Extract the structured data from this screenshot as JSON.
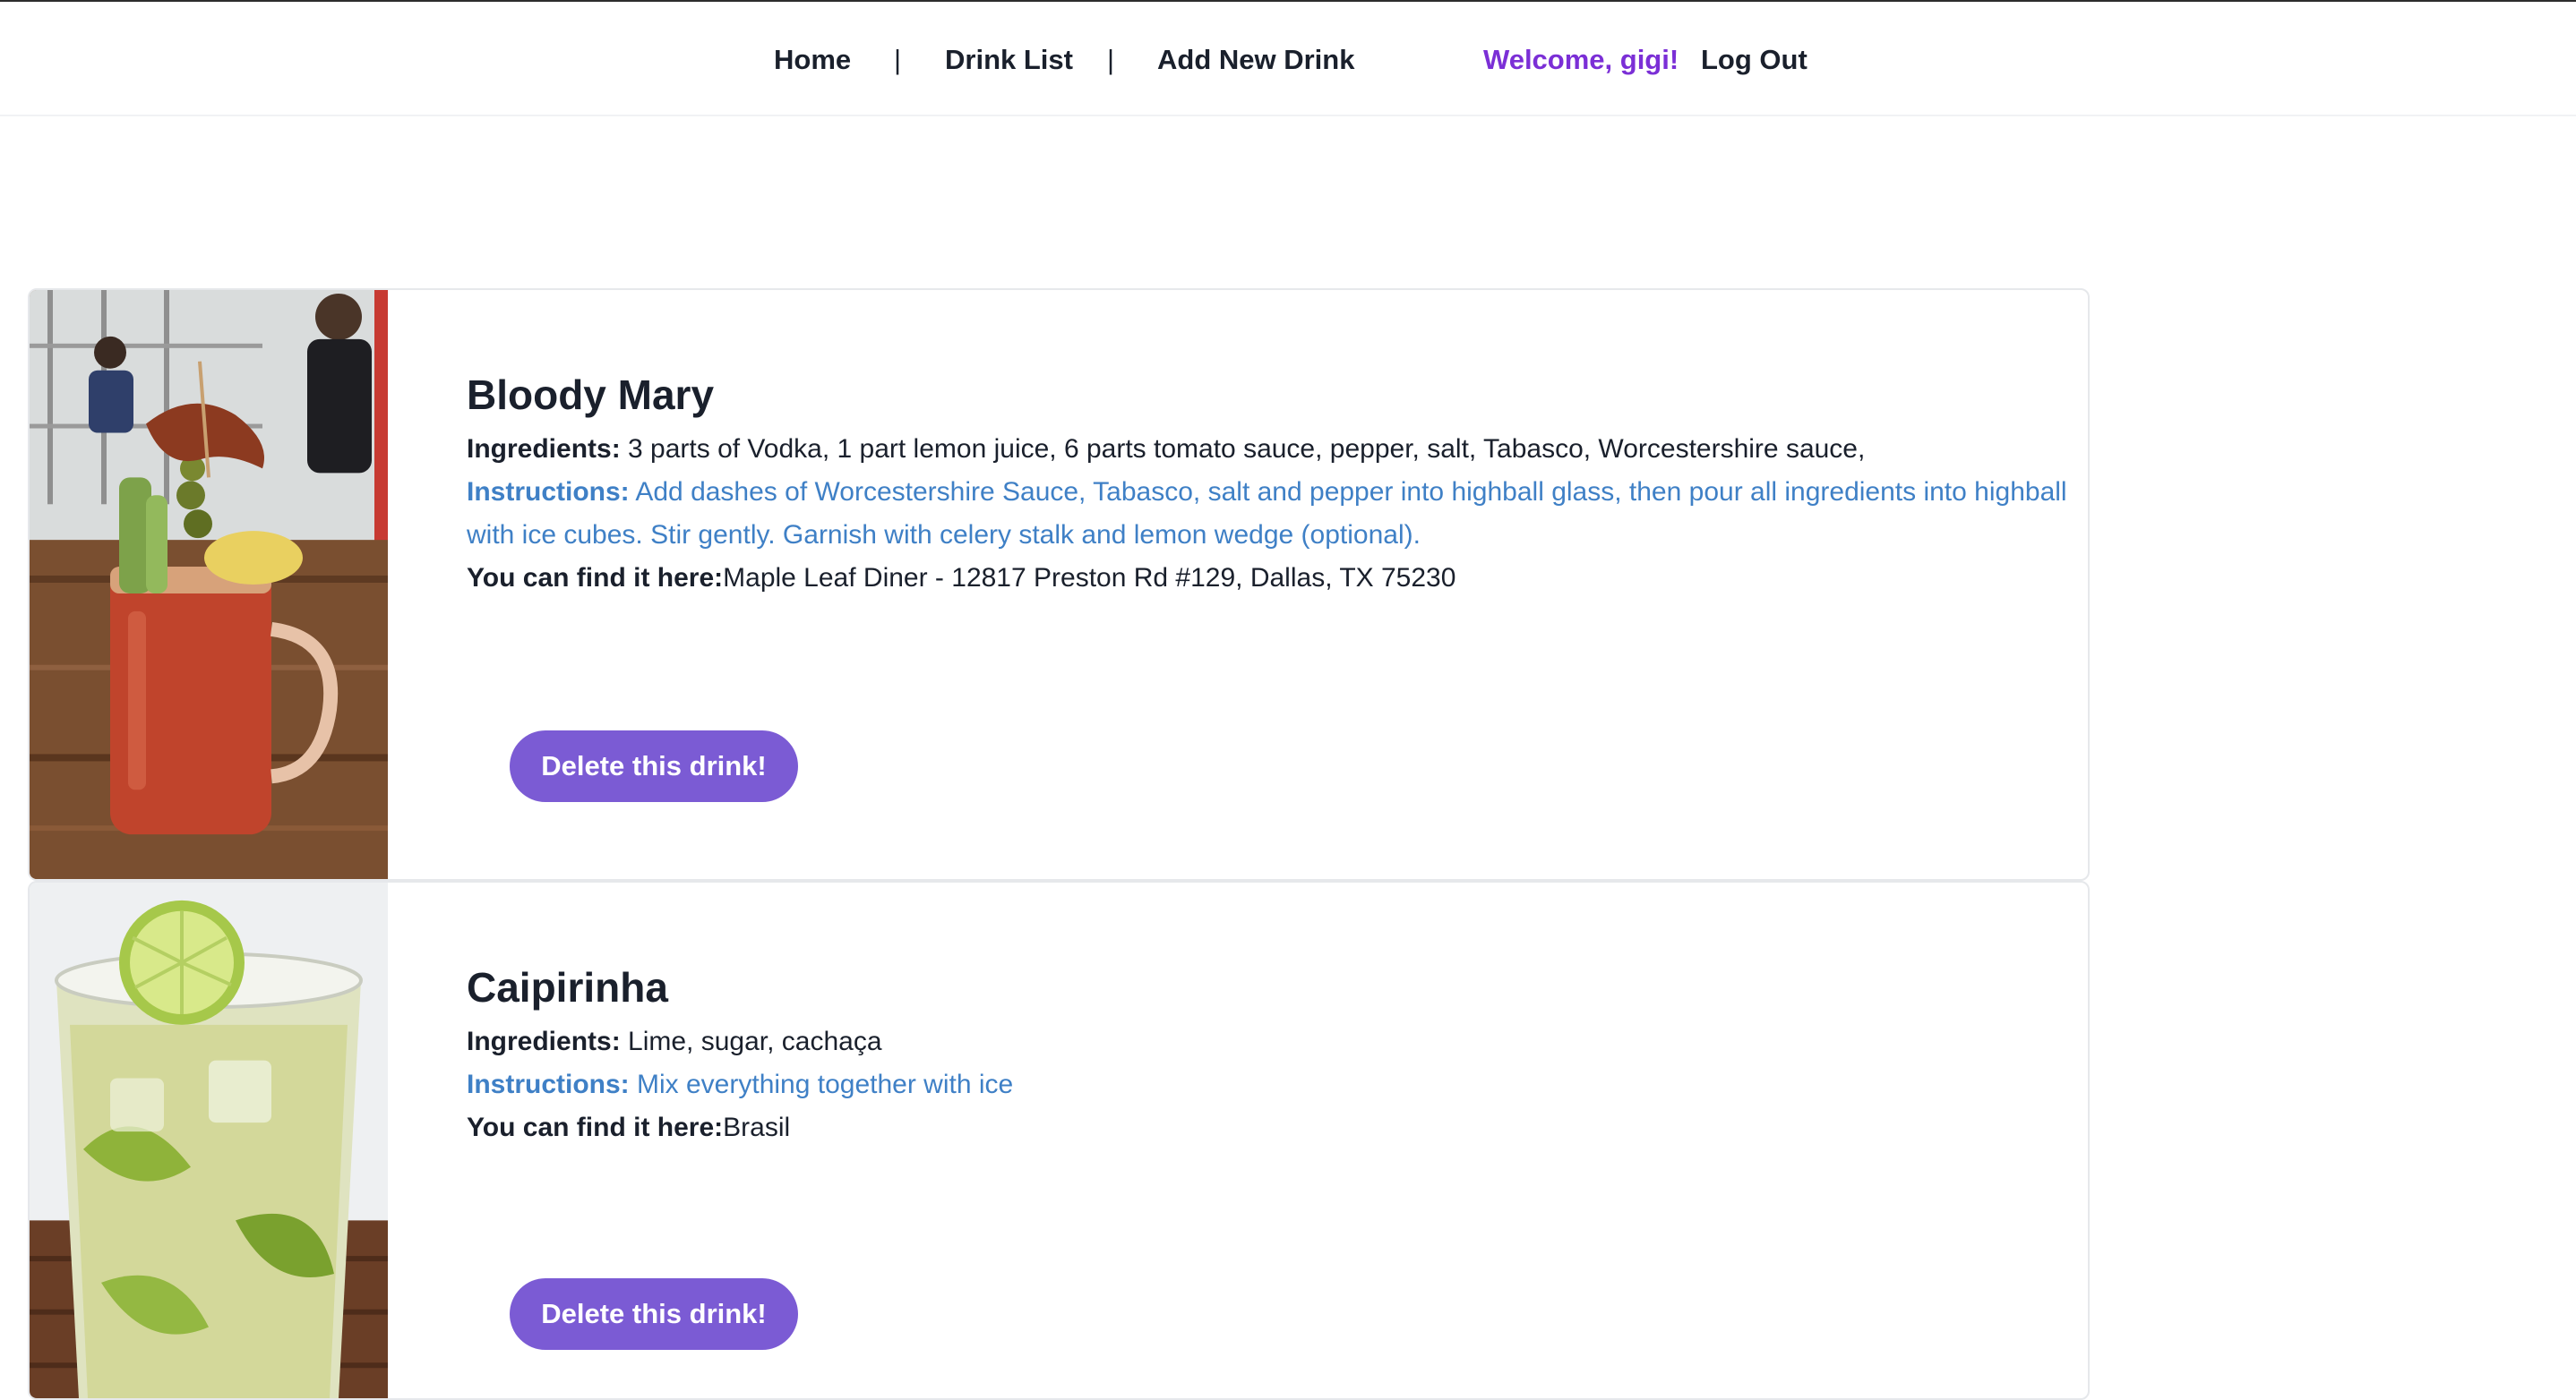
{
  "nav": {
    "home": "Home",
    "separator": "|",
    "drink_list": "Drink List",
    "add_new_drink": "Add New Drink",
    "welcome": "Welcome, gigi!",
    "log_out": "Log Out"
  },
  "drinks": [
    {
      "name": "Bloody Mary",
      "ingredients_label": "Ingredients:",
      "ingredients": " 3 parts of Vodka, 1 part lemon juice, 6 parts tomato sauce, pepper, salt, Tabasco, Worcestershire sauce,",
      "instructions_label": "Instructions:",
      "instructions": " Add dashes of Worcestershire Sauce, Tabasco, salt and pepper into highball glass, then pour all ingredients into highball with ice cubes. Stir gently. Garnish with celery stalk and lemon wedge (optional).",
      "location_label": "You can find it here:",
      "location": "Maple Leaf Diner - 12817 Preston Rd #129, Dallas, TX 75230",
      "delete_label": "Delete this drink!"
    },
    {
      "name": "Caipirinha",
      "ingredients_label": "Ingredients:",
      "ingredients": " Lime, sugar, cachaça",
      "instructions_label": "Instructions:",
      "instructions": " Mix everything together with ice",
      "location_label": "You can find it here:",
      "location": "Brasil",
      "delete_label": "Delete this drink!"
    }
  ],
  "colors": {
    "accent_purple": "#7b2fd6",
    "button_purple": "#7b5bd4",
    "instructions_blue": "#3f80c6",
    "text_dark": "#1a202c"
  }
}
